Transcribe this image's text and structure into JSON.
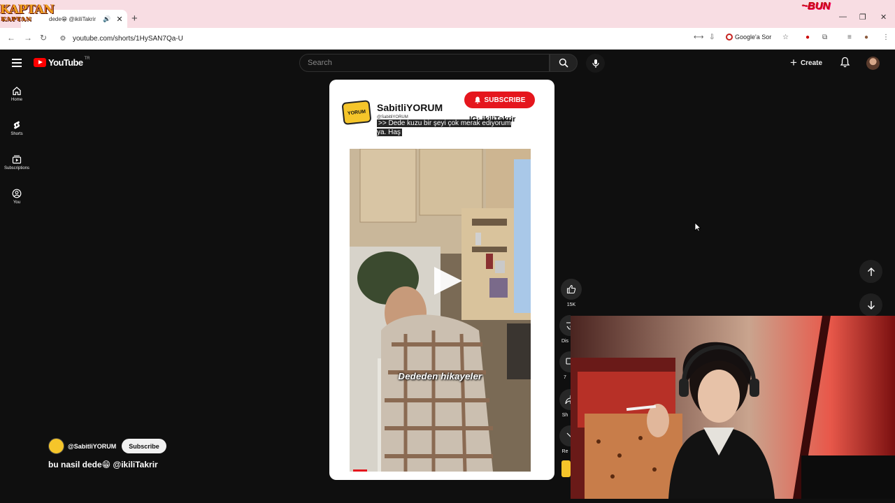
{
  "browser": {
    "tab_title": "dede😁 @ikiliTakrir",
    "url": "youtube.com/shorts/1HySAN7Qa-U",
    "ask_google_label": "Google'a Sor",
    "overlay_logo_text": "KAPTAN",
    "overlay_logo_subtext": "KAPTAN"
  },
  "youtube": {
    "logo_text": "YouTube",
    "country_code": "TR",
    "search_placeholder": "Search",
    "create_label": "Create",
    "sidebar": [
      {
        "label": "Home",
        "icon": "home-icon"
      },
      {
        "label": "Shorts",
        "icon": "shorts-icon"
      },
      {
        "label": "Subscriptions",
        "icon": "subscriptions-icon"
      },
      {
        "label": "You",
        "icon": "you-icon"
      }
    ]
  },
  "short": {
    "channel_name": "SabitliYORUM",
    "channel_handle": "@SabitliYORUM",
    "logo_text": "YORUM",
    "subscribe_label": "SUBSCRIBE",
    "ig_text": "IG: ikiliTakrir",
    "caption": ">> Dede kuzu bir şeyi çok merak ediyorum ya. Haş",
    "video_overlay_text": "Dededen hikayeler",
    "likes": "15K",
    "dislike_label": "Dis",
    "share_label": "Sh",
    "remix_label": "Re",
    "comments_count": "7"
  },
  "bottom": {
    "handle": "@SabitliYORUM",
    "subscribe_label": "Subscribe",
    "title": "bu nasil dede😁 @ikiliTakrir"
  },
  "colors": {
    "accent_red": "#ff0000",
    "subscribe_red": "#e5161d",
    "background": "#0f0f0f",
    "tab_strip": "#f8dde3"
  }
}
